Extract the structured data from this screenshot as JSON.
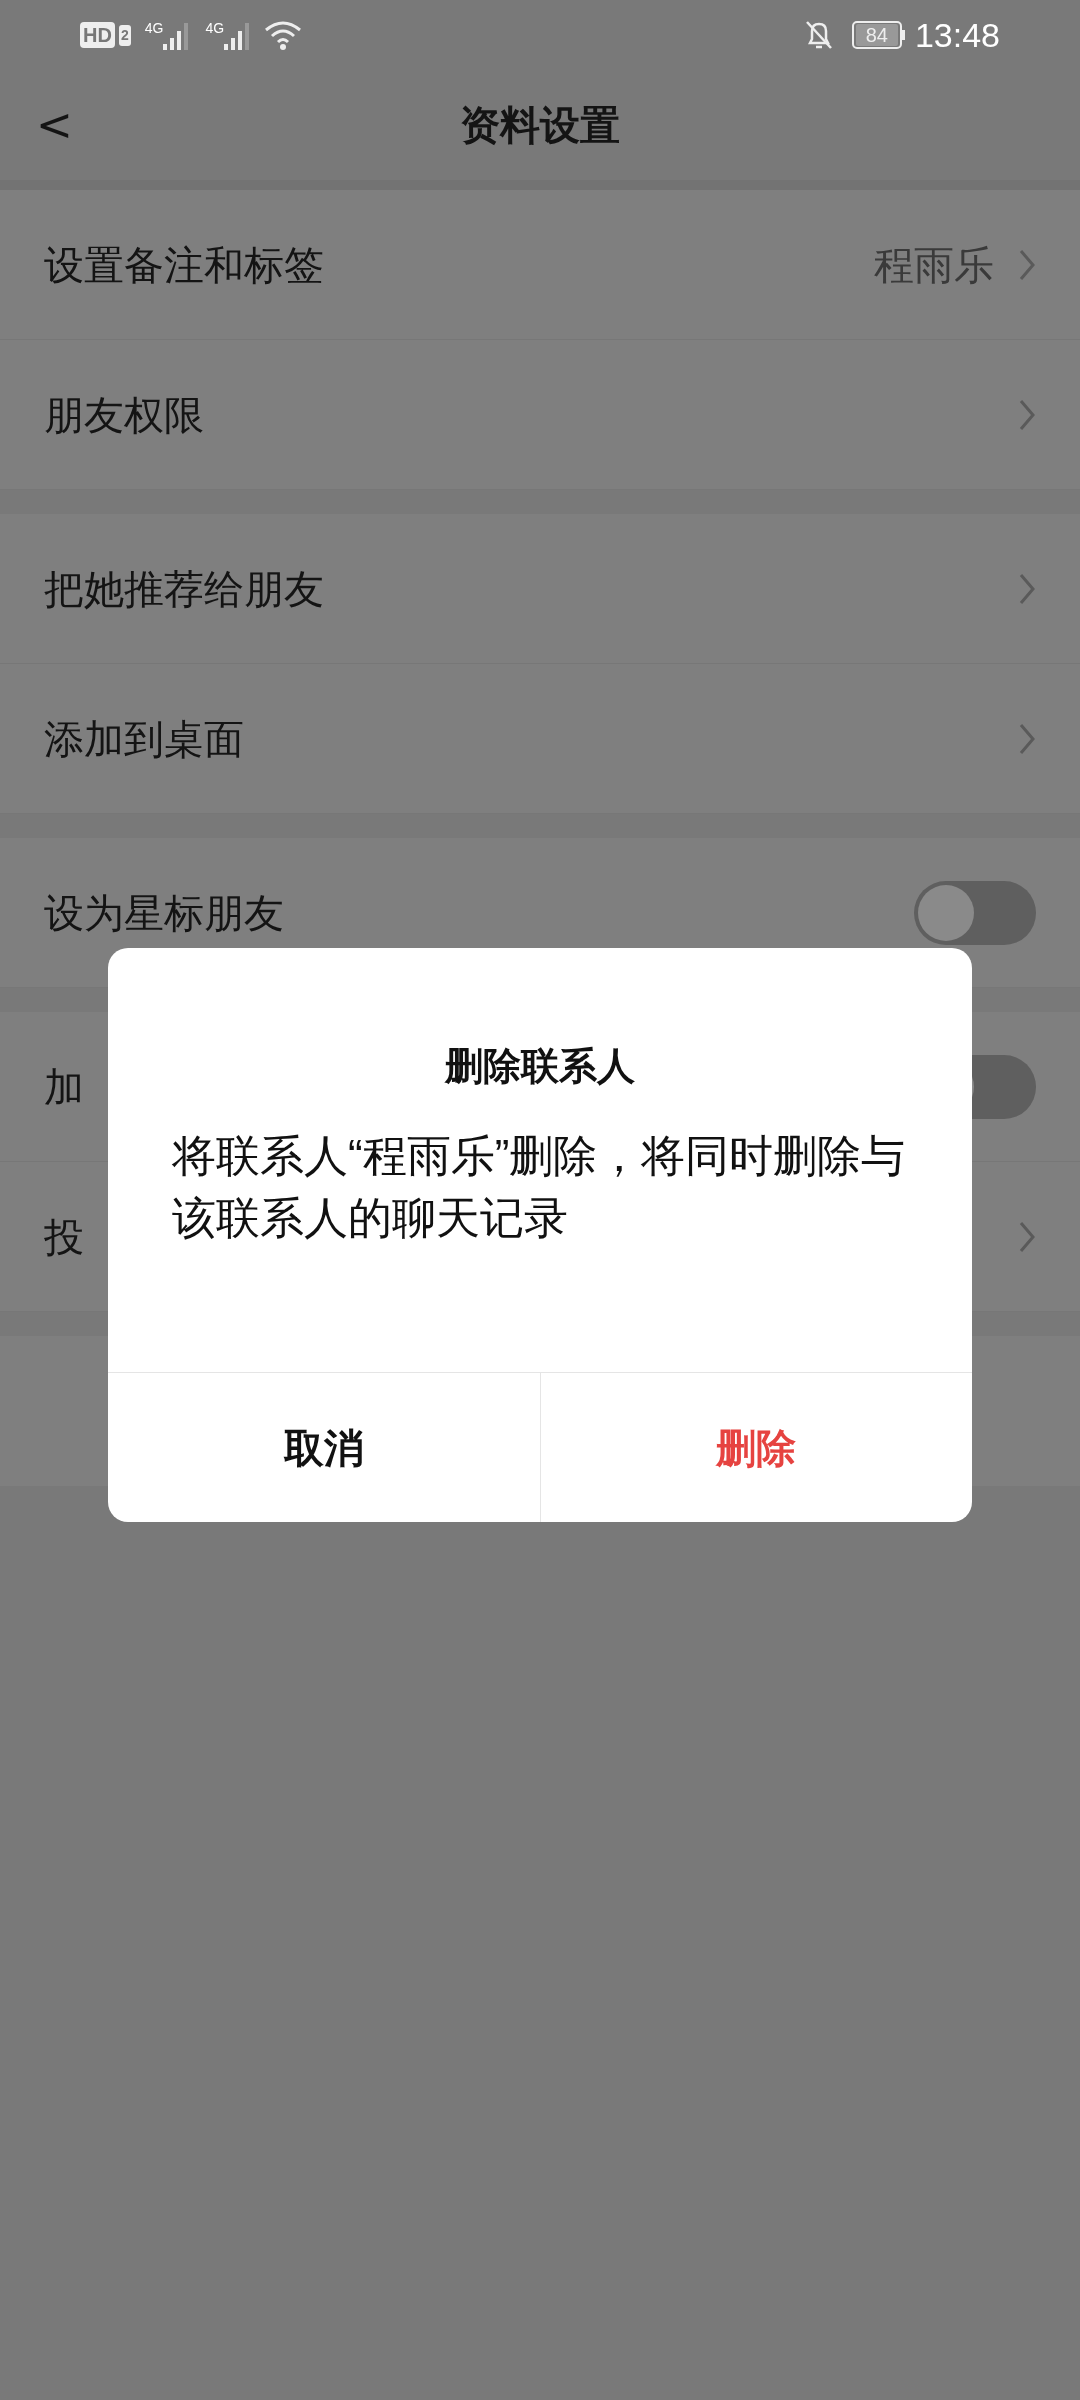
{
  "status_bar": {
    "time": "13:48",
    "battery": "84",
    "hd": "HD",
    "sim": "2",
    "net1": "4G",
    "net2": "4G"
  },
  "header": {
    "back": "<",
    "title": "资料设置"
  },
  "sections": [
    {
      "rows": [
        {
          "kind": "link",
          "label": "设置备注和标签",
          "value": "程雨乐"
        },
        {
          "kind": "link",
          "label": "朋友权限"
        }
      ]
    },
    {
      "rows": [
        {
          "kind": "link",
          "label": "把她推荐给朋友"
        },
        {
          "kind": "link",
          "label": "添加到桌面"
        }
      ]
    },
    {
      "rows": [
        {
          "kind": "toggle",
          "label": "设为星标朋友",
          "on": false
        }
      ]
    },
    {
      "rows": [
        {
          "kind": "toggle",
          "label": "加",
          "on": false
        },
        {
          "kind": "link",
          "label": "投"
        }
      ]
    },
    {
      "rows": [
        {
          "kind": "blank"
        }
      ]
    }
  ],
  "dialog": {
    "title": "删除联系人",
    "message": "将联系人“程雨乐”删除，将同时删除与该联系人的聊天记录",
    "buttons": [
      {
        "label": "取消",
        "kind": "cancel"
      },
      {
        "label": "删除",
        "kind": "danger"
      }
    ]
  }
}
